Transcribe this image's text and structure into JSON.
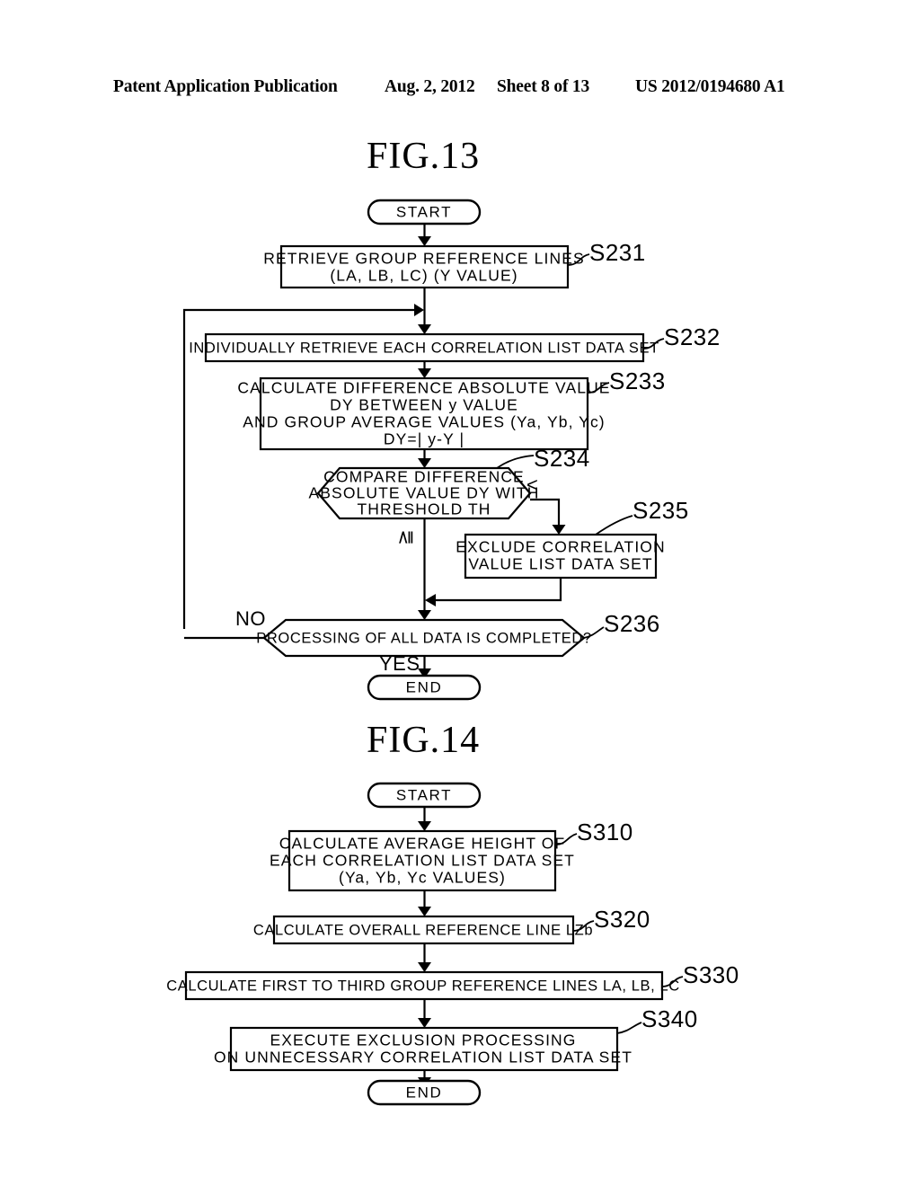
{
  "header": {
    "publication": "Patent Application Publication",
    "date": "Aug. 2, 2012",
    "sheet": "Sheet 8 of 13",
    "number": "US 2012/0194680 A1"
  },
  "figures": [
    {
      "title": "FIG.13",
      "nodes": {
        "start": {
          "label": "START"
        },
        "s231": {
          "ref": "S231",
          "lines": [
            "RETRIEVE GROUP REFERENCE LINES",
            "(LA, LB, LC) (Y VALUE)"
          ]
        },
        "s232": {
          "ref": "S232",
          "lines": [
            "INDIVIDUALLY RETRIEVE EACH CORRELATION LIST DATA SET"
          ]
        },
        "s233": {
          "ref": "S233",
          "lines": [
            "CALCULATE DIFFERENCE ABSOLUTE VALUE",
            "DY BETWEEN y VALUE",
            "AND GROUP AVERAGE VALUES (Ya, Yb, Yc)",
            "DY=| y-Y |"
          ]
        },
        "s234": {
          "ref": "S234",
          "lines": [
            "COMPARE DIFFERENCE",
            "ABSOLUTE VALUE DY WITH",
            "THRESHOLD TH"
          ],
          "branch_less": "<",
          "branch_geq": "≧"
        },
        "s235": {
          "ref": "S235",
          "lines": [
            "EXCLUDE CORRELATION",
            "VALUE LIST DATA SET"
          ]
        },
        "s236": {
          "ref": "S236",
          "lines": [
            "PROCESSING OF ALL DATA IS COMPLETED?"
          ],
          "branch_no": "NO",
          "branch_yes": "YES"
        },
        "end": {
          "label": "END"
        }
      }
    },
    {
      "title": "FIG.14",
      "nodes": {
        "start": {
          "label": "START"
        },
        "s310": {
          "ref": "S310",
          "lines": [
            "CALCULATE AVERAGE HEIGHT OF",
            "EACH CORRELATION LIST DATA SET",
            "(Ya, Yb, Yc VALUES)"
          ]
        },
        "s320": {
          "ref": "S320",
          "lines": [
            "CALCULATE OVERALL REFERENCE LINE LZb"
          ]
        },
        "s330": {
          "ref": "S330",
          "lines": [
            "CALCULATE FIRST TO THIRD GROUP REFERENCE LINES LA, LB, LC"
          ]
        },
        "s340": {
          "ref": "S340",
          "lines": [
            "EXECUTE EXCLUSION PROCESSING",
            "ON UNNECESSARY CORRELATION LIST DATA SET"
          ]
        },
        "end": {
          "label": "END"
        }
      }
    }
  ],
  "colors": {
    "ink": "#000000",
    "paper": "#ffffff"
  }
}
